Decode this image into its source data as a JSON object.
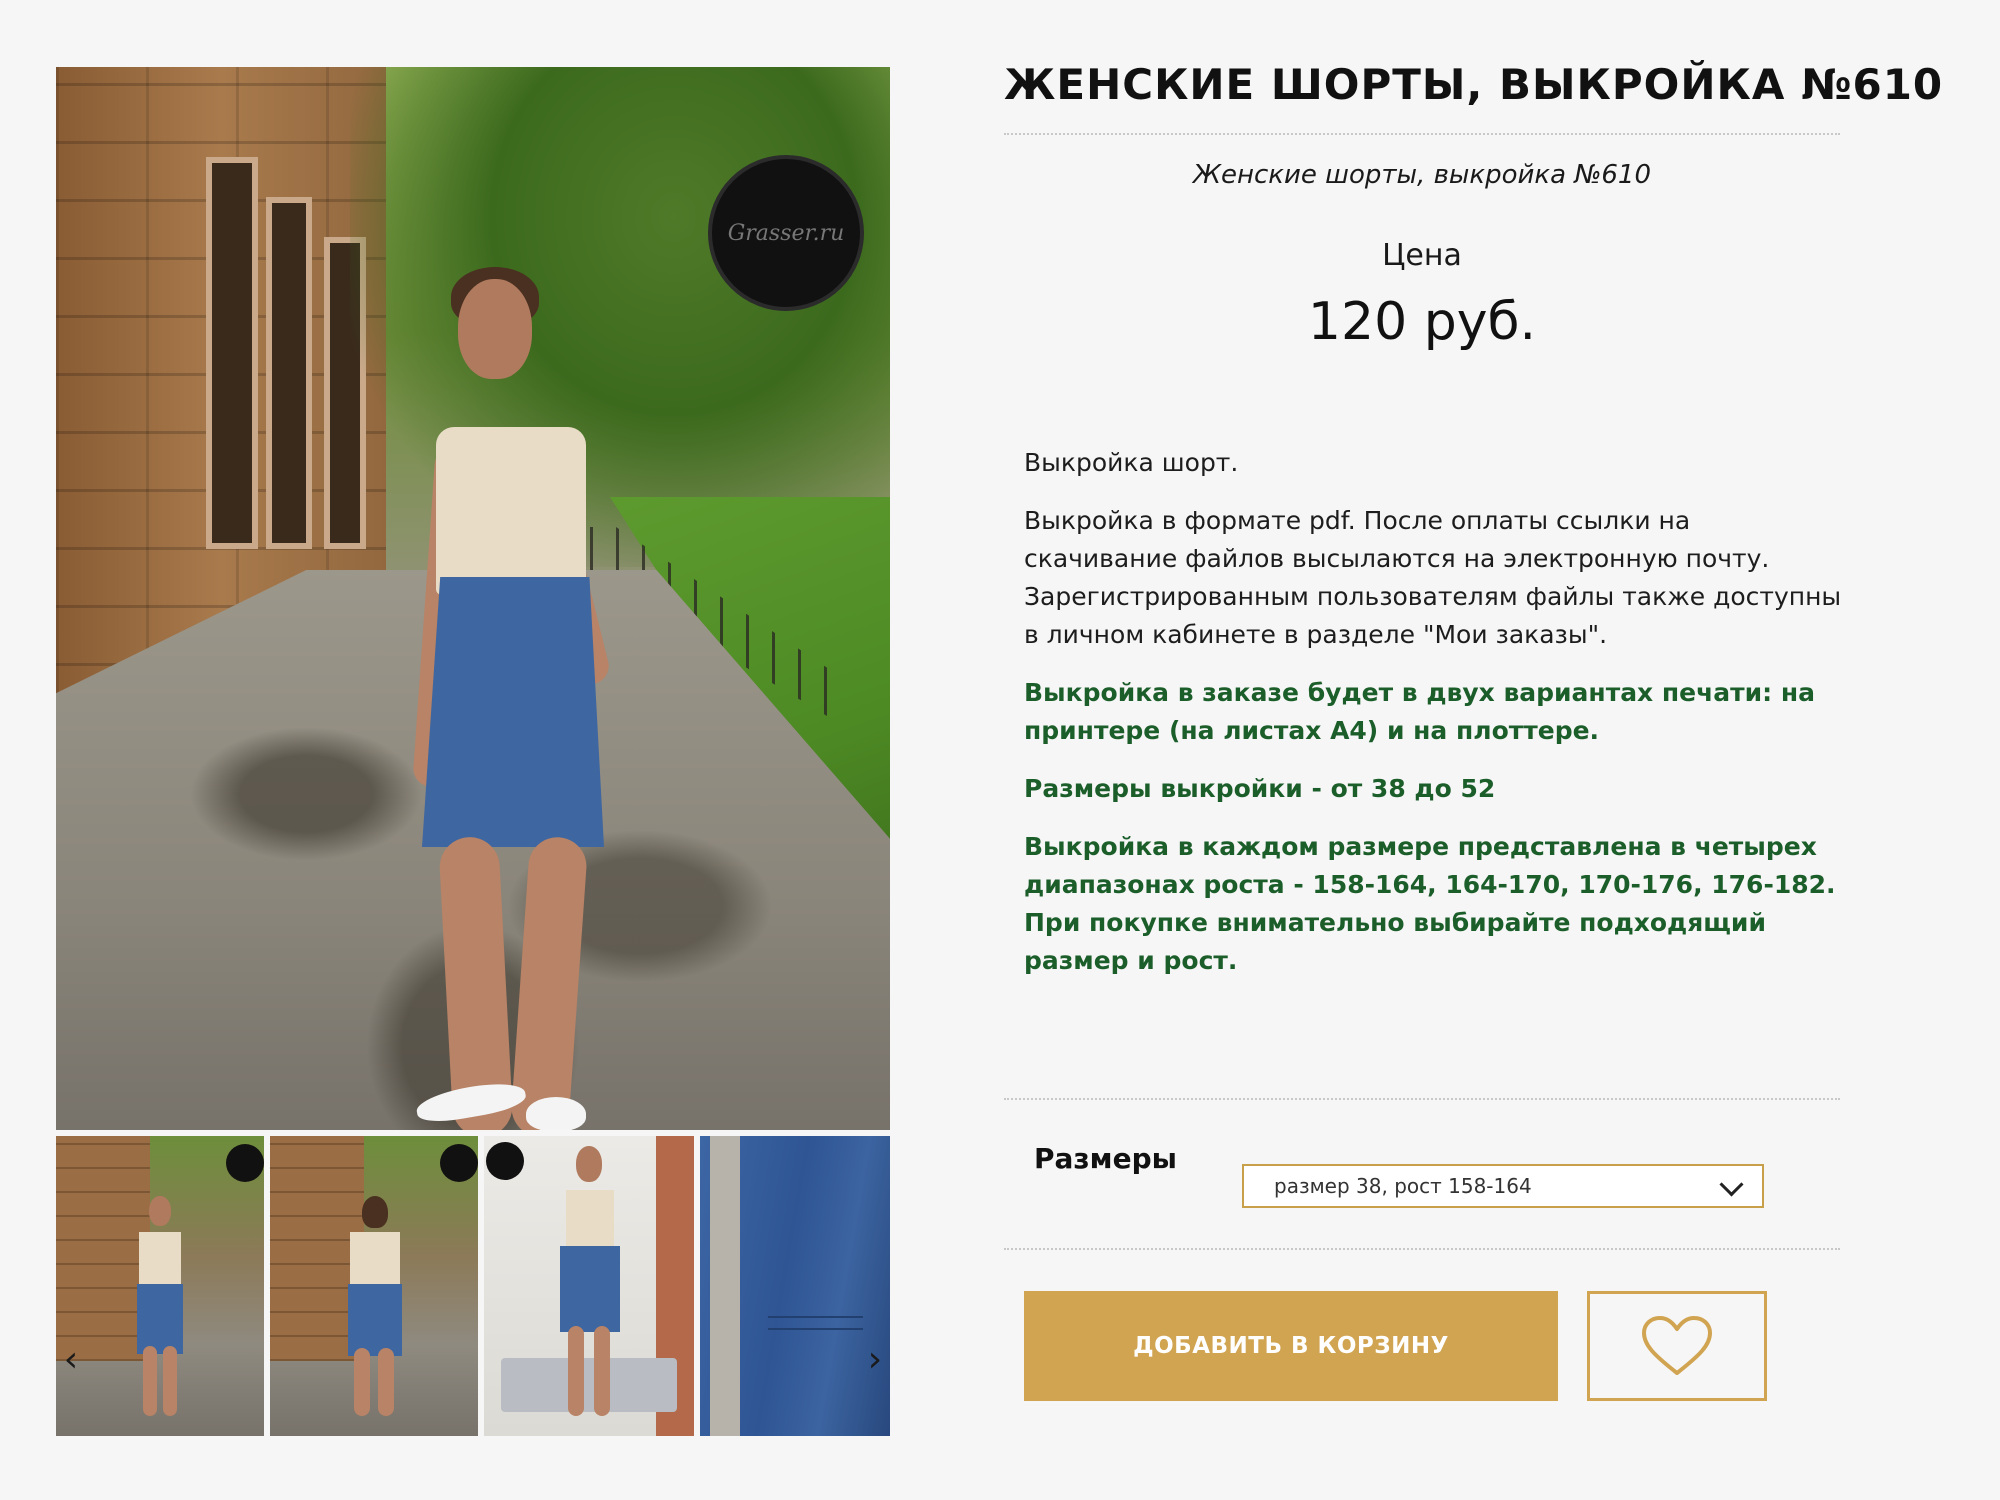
{
  "product": {
    "title": "ЖЕНСКИЕ ШОРТЫ, ВЫКРОЙКА №610",
    "subtitle": "Женские шорты, выкройка №610",
    "price_label": "Цена",
    "price_value": "120 руб."
  },
  "description": {
    "paragraphs": [
      "Выкройка шорт.",
      "Выкройка в формате pdf. После оплаты ссылки на скачивание файлов высылаются на электронную почту. Зарегистрированным пользователям файлы также доступны в личном кабинете в разделе \"Мои заказы\"."
    ],
    "highlights": [
      "Выкройка в заказе будет в двух вариантах печати: на принтере (на листах А4) и на плоттере.",
      "Размеры выкройки - от 38 до 52",
      "Выкройка в каждом размере представлена в четырех диапазонах роста - 158-164, 164-170, 170-176, 176-182. При покупке внимательно выбирайте подходящий размер и рост."
    ],
    "highlight_color": "#1b5e2a"
  },
  "options": {
    "sizes_label": "Размеры",
    "selected_size": "размер 38, рост 158-164"
  },
  "actions": {
    "add_to_cart_label": "ДОБАВИТЬ В КОРЗИНУ",
    "favorite_icon": "heart-icon",
    "accent_color": "#d1a452"
  },
  "gallery": {
    "prev_icon": "chevron-left-icon",
    "next_icon": "chevron-right-icon",
    "prev_glyph": "‹",
    "next_glyph": "›",
    "thumbnail_count": 4
  }
}
